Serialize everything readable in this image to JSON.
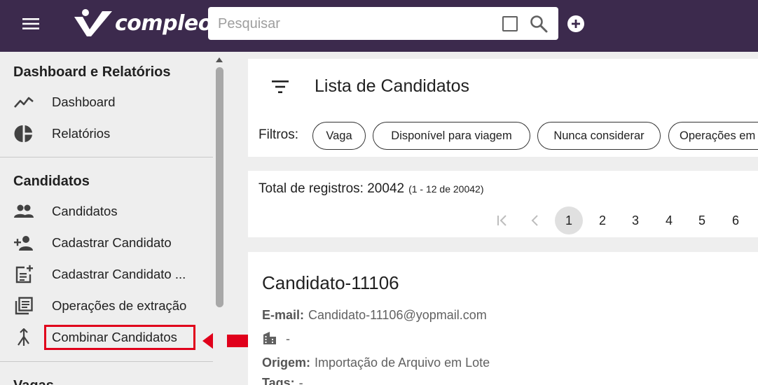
{
  "header": {
    "logo_text": "compleo",
    "search_placeholder": "Pesquisar",
    "brand_color": "#3c2a4d"
  },
  "sidebar": {
    "sections": [
      {
        "title": "Dashboard e Relatórios",
        "items": [
          {
            "label": "Dashboard",
            "icon": "trending-icon"
          },
          {
            "label": "Relatórios",
            "icon": "pie-chart-icon"
          }
        ]
      },
      {
        "title": "Candidatos",
        "items": [
          {
            "label": "Candidatos",
            "icon": "people-icon"
          },
          {
            "label": "Cadastrar Candidato",
            "icon": "person-add-icon"
          },
          {
            "label": "Cadastrar Candidato ...",
            "icon": "post-add-icon"
          },
          {
            "label": "Operações de extração",
            "icon": "library-books-icon"
          },
          {
            "label": "Combinar Candidatos",
            "icon": "merge-icon"
          }
        ]
      },
      {
        "title": "Vagas",
        "items": []
      }
    ],
    "highlight_color": "#e0001b"
  },
  "main": {
    "list_title": "Lista de Candidatos",
    "filters_label": "Filtros:",
    "chips": [
      "Vaga",
      "Disponível para viagem",
      "Nunca considerar",
      "Operações em"
    ],
    "total_label": "Total de registros: 20042",
    "total_range": "(1 - 12 de 20042)",
    "pages": [
      "1",
      "2",
      "3",
      "4",
      "5",
      "6"
    ],
    "active_page": "1",
    "candidate": {
      "name": "Candidato-11106",
      "email_label": "E-mail:",
      "email": "Candidato-11106@yopmail.com",
      "company": "-",
      "origin_label": "Origem:",
      "origin": "Importação de Arquivo em Lote",
      "tags_label": "Tags:",
      "tags": "-"
    }
  }
}
